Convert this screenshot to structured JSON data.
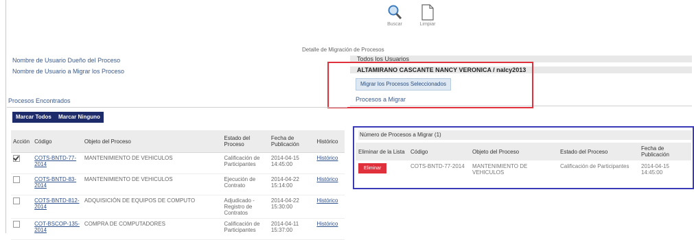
{
  "toolbar": {
    "buscar_label": "Buscar",
    "limpiar_label": "Limpiar"
  },
  "detalle_title": "Detalle de Migración de Procesos",
  "form": {
    "owner_label": "Nombre de Usuario Dueño del Proceso",
    "migrate_label": "Nombre de Usuario a Migrar los Proceso",
    "owner_value": "Todos los Usuarios",
    "migrate_value": "ALTAMIRANO CASCANTE NANCY VERONICA / nalcy2013",
    "migrate_button": "Migrar los Procesos Seleccionados",
    "procesos_a_migrar": "Procesos a Migrar"
  },
  "found": {
    "title": "Procesos Encontrados",
    "mark_all": "Marcar Todos",
    "mark_none": "Marcar Ninguno",
    "columns": [
      "Acción",
      "Código",
      "Objeto del Proceso",
      "Estado del Proceso",
      "Fecha de Publicación",
      "Histórico"
    ],
    "rows": [
      {
        "checked": true,
        "codigo": "COTS-BNTD-77-2014",
        "objeto": "MANTENIMIENTO DE VEHICULOS",
        "estado": "Calificación de Participantes",
        "fecha": "2014-04-15 14:45:00",
        "historico": "Histórico"
      },
      {
        "checked": false,
        "codigo": "COTS-BNTD-83-2014",
        "objeto": "MANTENIMIENTO DE VEHICULOS",
        "estado": "Ejecución de Contrato",
        "fecha": "2014-04-22 15:14:00",
        "historico": "Histórico"
      },
      {
        "checked": false,
        "codigo": "COTS-BNTD-812-2014",
        "objeto": "ADQUISICIÓN DE EQUIPOS DE COMPUTO",
        "estado": "Adjudicado - Registro de Contratos",
        "fecha": "2014-04-22 15:30:00",
        "historico": "Histórico"
      },
      {
        "checked": false,
        "codigo": "COT-BSCOP-135-2014",
        "objeto": "COMPRA DE COMPUTADORES",
        "estado": "Calificación de Participantes",
        "fecha": "2014-04-11 15:37:00",
        "historico": "Histórico"
      }
    ]
  },
  "migrate": {
    "title": "Número de Procesos a Migrar (1)",
    "columns": [
      "Eliminar de la Lista",
      "Código",
      "Objeto del Proceso",
      "Estado del Proceso",
      "Fecha de Publicación"
    ],
    "rows": [
      {
        "action": "Eliminar",
        "codigo": "COTS-BNTD-77-2014",
        "objeto": "MANTENIMIENTO DE VEHICULOS",
        "estado": "Calificación de Participantes",
        "fecha": "2014-04-15 14:45:00"
      }
    ]
  },
  "colors": {
    "highlight_red": "#e0303b",
    "highlight_blue": "#3a3ab8",
    "dark_button": "#1e2b6b",
    "link": "#2d4f8c"
  }
}
